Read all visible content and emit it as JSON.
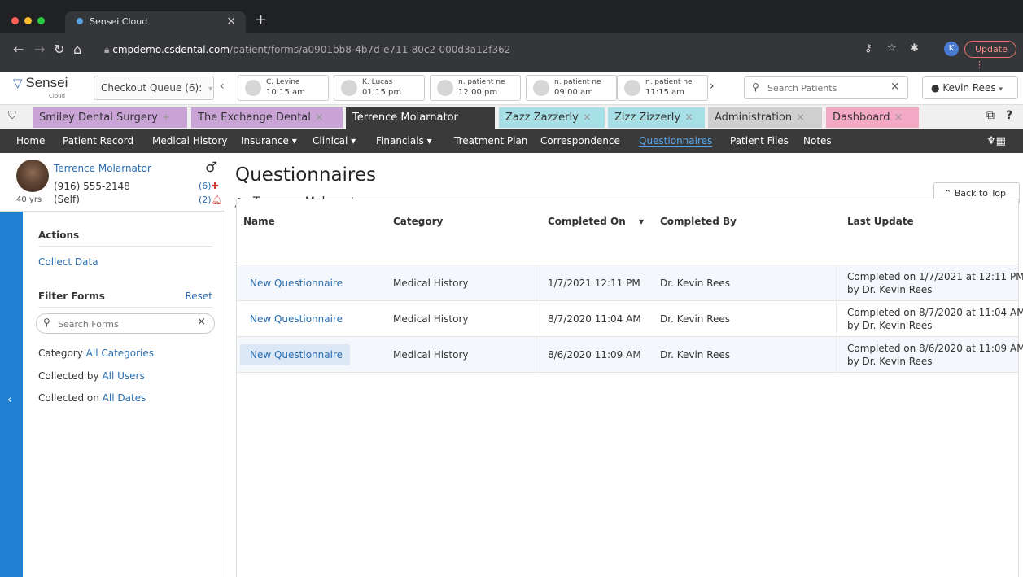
{
  "browser": {
    "tab_title": "Sensei Cloud",
    "url_domain": "cmpdemo.csdental.com",
    "url_path": "/patient/forms/a0901bb8-4b7d-e711-80c2-000d3a12f362",
    "profile_initial": "K",
    "update_label": "Update"
  },
  "app": {
    "logo_text": "Sensei",
    "logo_sub": "Cloud",
    "checkout_queue": "Checkout Queue (6):",
    "appointments": [
      {
        "name": "C. Levine",
        "time": "10:15 am"
      },
      {
        "name": "K. Lucas",
        "time": "01:15 pm"
      },
      {
        "name": "n. patient ne",
        "time": "12:00 pm"
      },
      {
        "name": "n. patient ne",
        "time": "09:00 am"
      },
      {
        "name": "n. patient ne",
        "time": "11:15 am"
      }
    ],
    "search_placeholder": "Search Patients",
    "user_name": "Kevin Rees"
  },
  "workspace_tabs": [
    {
      "label": "Smiley Dental Surgery",
      "close": "+",
      "color": "#c9a3d6"
    },
    {
      "label": "The Exchange Dental",
      "close": "×",
      "color": "#c9a3d6"
    },
    {
      "label": "Terrence Molarnator",
      "close": "",
      "color": "#3a3a3a"
    },
    {
      "label": "Zazz Zazzerly",
      "close": "×",
      "color": "#a6dfe6"
    },
    {
      "label": "Zizz Zizzerly",
      "close": "×",
      "color": "#a6dfe6"
    },
    {
      "label": "Administration",
      "close": "×",
      "color": "#cfcfcf"
    },
    {
      "label": "Dashboard",
      "close": "×",
      "color": "#f3a8c4"
    }
  ],
  "nav": {
    "home": "Home",
    "patient_record": "Patient Record",
    "medical_history": "Medical History",
    "insurance": "Insurance ▾",
    "clinical": "Clinical ▾",
    "financials": "Financials ▾",
    "treatment_plan": "Treatment Plan",
    "correspondence": "Correspondence",
    "questionnaires": "Questionnaires",
    "patient_files": "Patient Files",
    "notes": "Notes"
  },
  "patient": {
    "name": "Terrence Molarnator",
    "phone": "(916) 555-2148",
    "relation": "(Self)",
    "age": "40 yrs",
    "alerts_count": "(6)",
    "notices_count": "(2)"
  },
  "sidebar": {
    "actions_label": "Actions",
    "collect_data": "Collect Data",
    "filter_label": "Filter Forms",
    "reset": "Reset",
    "search_placeholder": "Search Forms",
    "category_label": "Category",
    "category_value": "All Categories",
    "collected_by_label": "Collected by",
    "collected_by_value": "All Users",
    "collected_on_label": "Collected on",
    "collected_on_value": "All Dates"
  },
  "main": {
    "title": "Questionnaires",
    "for_label": "for",
    "patient": "Terrence Molarnator",
    "back_to_top": "Back to Top",
    "columns": [
      "Name",
      "Category",
      "Completed On",
      "Completed By",
      "Last Update"
    ],
    "rows": [
      {
        "name": "New Questionnaire",
        "category": "Medical History",
        "completed_on": "1/7/2021 12:11 PM",
        "completed_by": "Dr. Kevin Rees",
        "last_update": "Completed on 1/7/2021 at 12:11 PM by Dr. Kevin Rees"
      },
      {
        "name": "New Questionnaire",
        "category": "Medical History",
        "completed_on": "8/7/2020 11:04 AM",
        "completed_by": "Dr. Kevin Rees",
        "last_update": "Completed on 8/7/2020 at 11:04 AM by Dr. Kevin Rees"
      },
      {
        "name": "New Questionnaire",
        "category": "Medical History",
        "completed_on": "8/6/2020 11:09 AM",
        "completed_by": "Dr. Kevin Rees",
        "last_update": "Completed on 8/6/2020 at 11:09 AM by Dr. Kevin Rees"
      }
    ]
  }
}
